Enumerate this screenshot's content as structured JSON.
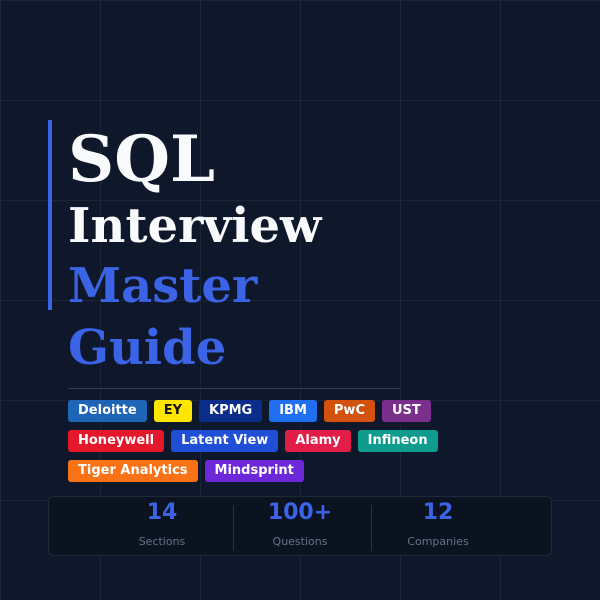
{
  "title": {
    "line1": "SQL",
    "line2": "Interview",
    "line3": "Master",
    "line4": "Guide"
  },
  "colors": {
    "background": "#0f172a",
    "accent": "#3b63e6",
    "title_text": "#f8fafc",
    "stat_label": "#64748b"
  },
  "companies": [
    [
      {
        "label": "Deloitte",
        "bg": "#1e65b8",
        "fg": "#ffffff"
      },
      {
        "label": "EY",
        "bg": "#ffe600",
        "fg": "#111111"
      },
      {
        "label": "KPMG",
        "bg": "#0a2d8a",
        "fg": "#ffffff"
      },
      {
        "label": "IBM",
        "bg": "#1f6ff0",
        "fg": "#ffffff"
      },
      {
        "label": "PwC",
        "bg": "#d2510d",
        "fg": "#ffffff"
      },
      {
        "label": "UST",
        "bg": "#7b2f8c",
        "fg": "#ffffff"
      }
    ],
    [
      {
        "label": "Honeywell",
        "bg": "#e3192b",
        "fg": "#ffffff"
      },
      {
        "label": "Latent View",
        "bg": "#1f4fd6",
        "fg": "#ffffff"
      },
      {
        "label": "Alamy",
        "bg": "#e11d48",
        "fg": "#ffffff"
      },
      {
        "label": "Infineon",
        "bg": "#0f9c8e",
        "fg": "#ffffff"
      }
    ],
    [
      {
        "label": "Tiger Analytics",
        "bg": "#f97316",
        "fg": "#ffffff"
      },
      {
        "label": "Mindsprint",
        "bg": "#6d28d9",
        "fg": "#ffffff"
      }
    ]
  ],
  "stats": [
    {
      "value": "14",
      "label": "Sections"
    },
    {
      "value": "100+",
      "label": "Questions"
    },
    {
      "value": "12",
      "label": "Companies"
    }
  ]
}
